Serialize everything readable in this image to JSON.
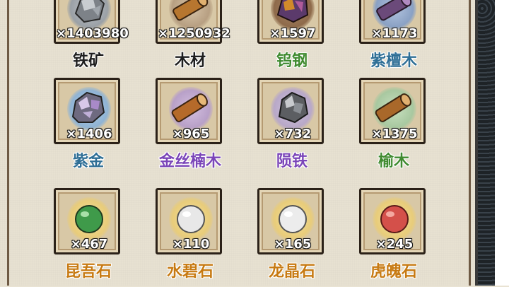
{
  "items": [
    {
      "qty": "×1403980",
      "name": "铁矿",
      "name_color": "#1e1e1e",
      "icon": "iron-ore-icon",
      "glow": "#9aa0a6"
    },
    {
      "qty": "×1250932",
      "name": "木材",
      "name_color": "#1e1e1e",
      "icon": "wood-log-icon",
      "glow": "#b79f82"
    },
    {
      "qty": "×1597",
      "name": "钨钢",
      "name_color": "#3f8a2f",
      "icon": "tungsten-steel-icon",
      "glow": "#8e6a4a"
    },
    {
      "qty": "×1173",
      "name": "紫檀木",
      "name_color": "#2f6f96",
      "icon": "rosewood-icon",
      "glow": "#8aa1c4"
    },
    {
      "qty": "×1406",
      "name": "紫金",
      "name_color": "#2f6f96",
      "icon": "purple-gold-ore-icon",
      "glow": "#8fb3d4"
    },
    {
      "qty": "×965",
      "name": "金丝楠木",
      "name_color": "#7a45b8",
      "icon": "golden-nanmu-log-icon",
      "glow": "#b8a0c8"
    },
    {
      "qty": "×732",
      "name": "陨铁",
      "name_color": "#7a45b8",
      "icon": "meteorite-iron-icon",
      "glow": "#b8a8c8"
    },
    {
      "qty": "×1375",
      "name": "榆木",
      "name_color": "#3f8a2f",
      "icon": "elm-log-icon",
      "glow": "#a8c8a0"
    },
    {
      "qty": "×467",
      "name": "昆吾石",
      "name_color": "#c77a12",
      "icon": "green-stone-icon",
      "glow": "#e8cc7a"
    },
    {
      "qty": "×110",
      "name": "水碧石",
      "name_color": "#c77a12",
      "icon": "white-stone-icon",
      "glow": "#e8cc7a"
    },
    {
      "qty": "×165",
      "name": "龙晶石",
      "name_color": "#c77a12",
      "icon": "white-crystal-stone-icon",
      "glow": "#e8cc7a"
    },
    {
      "qty": "×245",
      "name": "虎魄石",
      "name_color": "#c77a12",
      "icon": "red-stone-icon",
      "glow": "#e8cc7a"
    }
  ]
}
